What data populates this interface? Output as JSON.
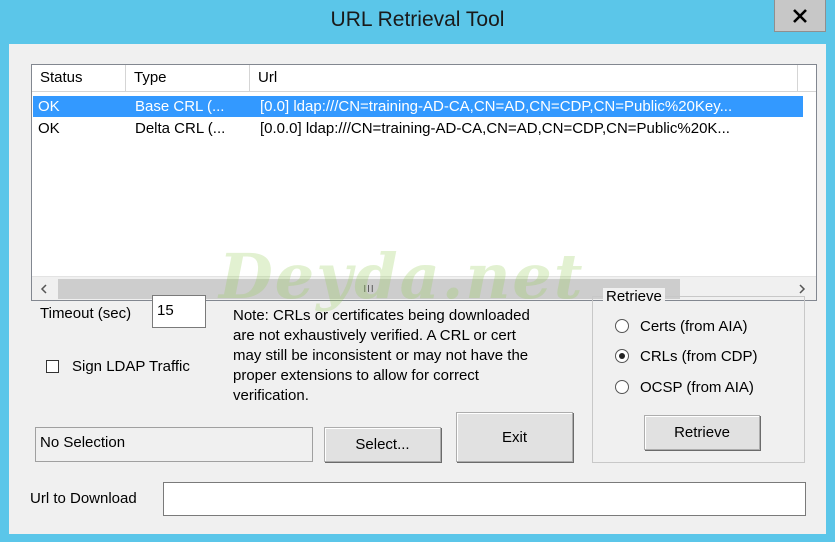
{
  "window": {
    "title": "URL Retrieval Tool"
  },
  "list": {
    "columns": [
      "Status",
      "Type",
      "Url"
    ],
    "rows": [
      {
        "status": "OK",
        "type": "Base CRL (...",
        "url": "[0.0] ldap:///CN=training-AD-CA,CN=AD,CN=CDP,CN=Public%20Key...",
        "selected": true
      },
      {
        "status": "OK",
        "type": "Delta CRL (...",
        "url": "[0.0.0] ldap:///CN=training-AD-CA,CN=AD,CN=CDP,CN=Public%20K...",
        "selected": false
      }
    ],
    "thumb_grip": "III"
  },
  "timeout": {
    "label": "Timeout (sec)",
    "value": "15"
  },
  "sign_ldap": {
    "label": "Sign LDAP Traffic",
    "checked": false
  },
  "note": [
    "Note: CRLs or certificates being downloaded",
    "are not exhaustively verified.  A CRL or cert",
    "may still be inconsistent or may not have the",
    "proper extensions to allow for correct",
    "verification."
  ],
  "selection": {
    "value": "No Selection"
  },
  "buttons": {
    "select": "Select...",
    "exit": "Exit",
    "retrieve": "Retrieve"
  },
  "retrieve_group": {
    "title": "Retrieve",
    "options": [
      {
        "label": "Certs (from AIA)",
        "checked": false
      },
      {
        "label": "CRLs (from CDP)",
        "checked": true
      },
      {
        "label": "OCSP (from AIA)",
        "checked": false
      }
    ]
  },
  "url_to_download": {
    "label": "Url to Download",
    "value": ""
  },
  "watermark": "Deyda.net",
  "colors": {
    "titlebar": "#5bc6e9",
    "selection": "#3399ff",
    "dialog": "#f0f0f0"
  }
}
